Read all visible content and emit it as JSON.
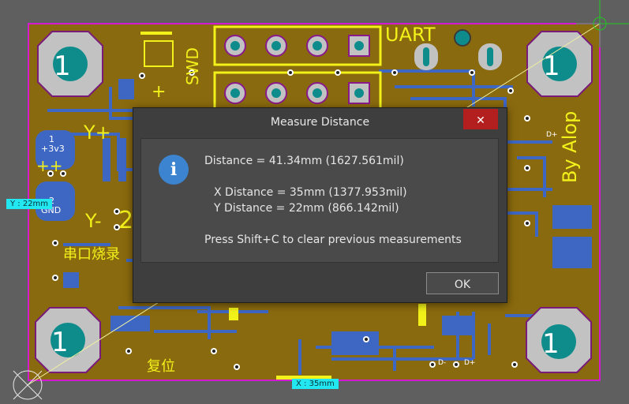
{
  "pcb": {
    "hole_label": "1",
    "labels": {
      "uart": "UART",
      "swd": "SWD",
      "by_alop": "By Alop",
      "plus3v3": "+3v3",
      "plus_plus": "++",
      "gnd": "GND",
      "pin1": "1",
      "pin2": "2",
      "y_plus": "Y+",
      "y_minus": "Y-",
      "two": "2",
      "serial_flash": "串口烧录",
      "reset": "复位",
      "plus": "+",
      "d_plus": "D+",
      "d_minus": "D-"
    }
  },
  "measure": {
    "y_tag": "Y : 22mm",
    "x_tag": "X : 35mm"
  },
  "dialog": {
    "title": "Measure Distance",
    "close_glyph": "✕",
    "info_glyph": "i",
    "distance": "Distance = 41.34mm (1627.561mil)",
    "x_distance": "X Distance = 35mm (1377.953mil)",
    "y_distance": "Y Distance = 22mm (866.142mil)",
    "hint": "Press Shift+C to clear previous measurements",
    "ok_label": "OK"
  },
  "colors": {
    "board": "#8a6a0e",
    "silkscreen": "#f2f21a",
    "copper_bottom": "#3e67c4",
    "mounting_pad": "#c2c2c2",
    "board_outline": "#d11ad1",
    "measure_line": "#f0f0a0",
    "close_button": "#b31f1f",
    "info_icon": "#3c84cf"
  }
}
